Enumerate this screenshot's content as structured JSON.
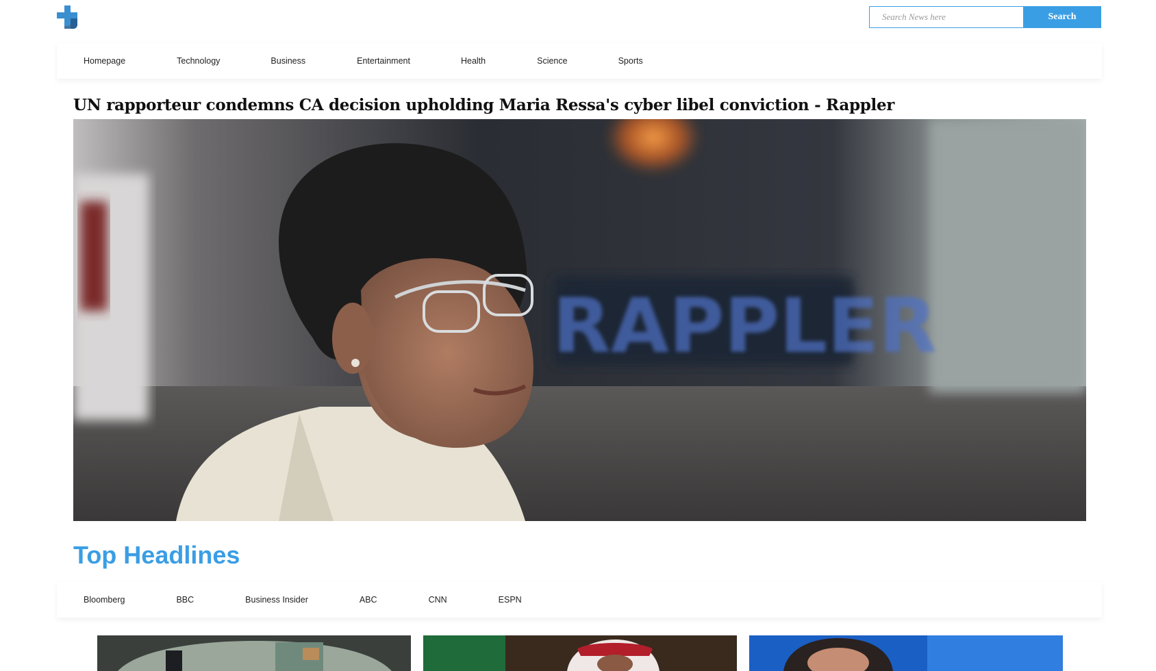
{
  "header": {
    "logo_icon": "plus-logo-icon",
    "search": {
      "placeholder": "Search News here",
      "button_label": "Search"
    }
  },
  "nav": {
    "items": [
      {
        "label": "Homepage"
      },
      {
        "label": "Technology"
      },
      {
        "label": "Business"
      },
      {
        "label": "Entertainment"
      },
      {
        "label": "Health"
      },
      {
        "label": "Science"
      },
      {
        "label": "Sports"
      }
    ]
  },
  "featured": {
    "title": "UN rapporteur condemns CA decision upholding Maria Ressa's cyber libel conviction - Rappler",
    "image_icon": "featured-news-photo"
  },
  "top_headlines": {
    "title": "Top Headlines",
    "sources": [
      {
        "label": "Bloomberg"
      },
      {
        "label": "BBC"
      },
      {
        "label": "Business Insider"
      },
      {
        "label": "ABC"
      },
      {
        "label": "CNN"
      },
      {
        "label": "ESPN"
      }
    ]
  },
  "colors": {
    "accent": "#3a9ee4",
    "text": "#222222",
    "background": "#ffffff"
  }
}
